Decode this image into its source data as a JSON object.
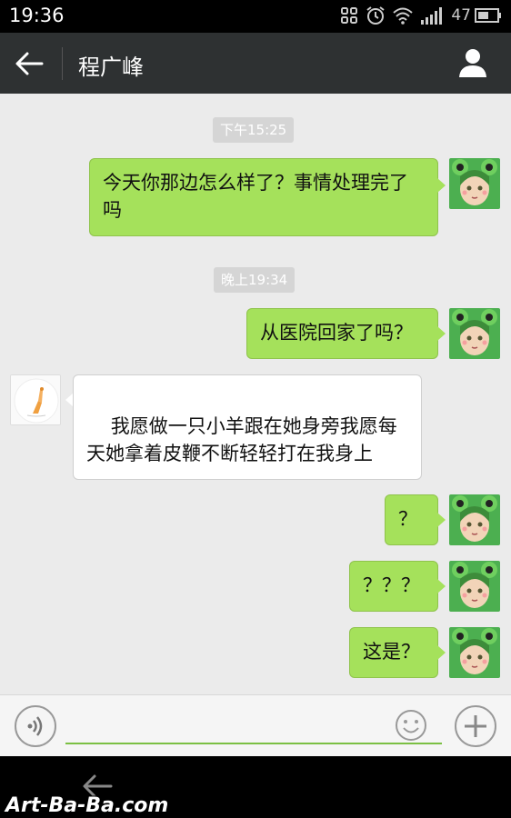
{
  "status_bar": {
    "time": "19:36",
    "battery_level": "47",
    "icons": [
      "app-grid-icon",
      "alarm-clock-icon",
      "wifi-icon",
      "signal-icon",
      "battery-icon"
    ]
  },
  "header": {
    "title": "程广峰",
    "back_icon": "back-arrow-icon",
    "profile_icon": "person-icon"
  },
  "messages": [
    {
      "type": "timestamp",
      "text": "下午15:25"
    },
    {
      "type": "message",
      "direction": "out",
      "text": "今天你那边怎么样了？事情处理完了吗"
    },
    {
      "type": "timestamp",
      "text": "晚上19:34"
    },
    {
      "type": "message",
      "direction": "out",
      "text": "从医院回家了吗？"
    },
    {
      "type": "message",
      "direction": "in",
      "text": "我愿做一只小羊跟在她身旁我愿每天她拿着皮鞭不断轻轻打在我身上"
    },
    {
      "type": "message",
      "direction": "out",
      "text": "？"
    },
    {
      "type": "message",
      "direction": "out",
      "text": "？？？"
    },
    {
      "type": "message",
      "direction": "out",
      "text": "这是？"
    }
  ],
  "input_bar": {
    "value": "",
    "voice_icon": "voice-icon",
    "emoji_icon": "emoji-icon",
    "plus_icon": "plus-icon"
  },
  "watermark": "Art-Ba-Ba.com",
  "colors": {
    "outgoing_bubble": "#a5e15b",
    "incoming_bubble": "#ffffff",
    "chat_background": "#ebebeb",
    "title_bar": "#2e3132",
    "input_underline": "#7bc043"
  }
}
